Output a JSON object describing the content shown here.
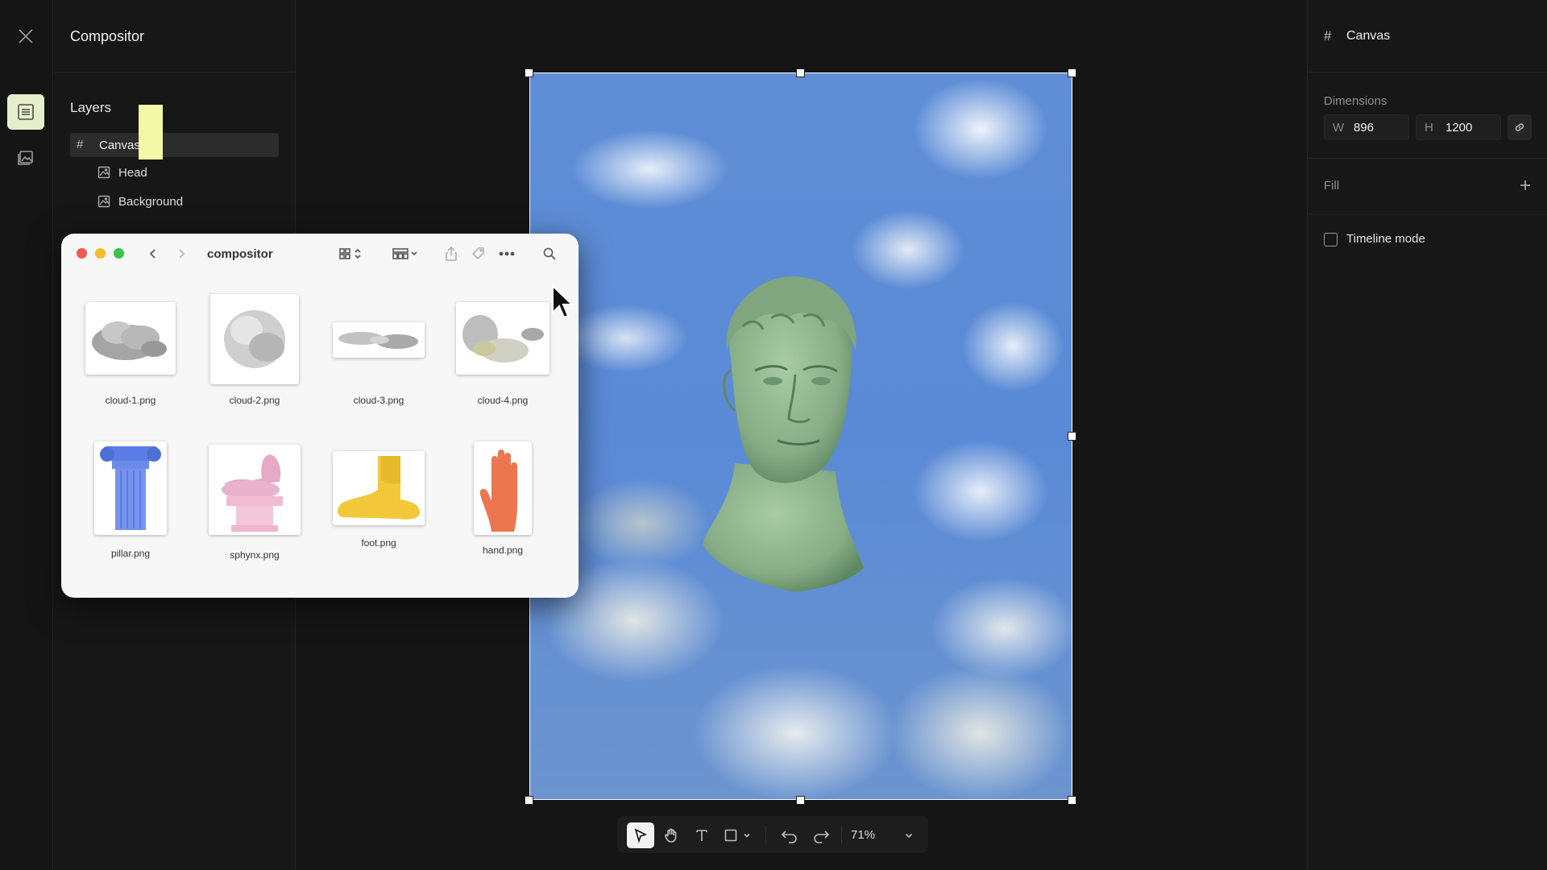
{
  "app": {
    "title": "Compositor"
  },
  "rail": {
    "close_icon": "close-icon",
    "layers_icon": "menu-lines-icon",
    "assets_icon": "images-icon",
    "active_color": "#e7eecb"
  },
  "layers": {
    "title": "Layers",
    "items": [
      {
        "label": "Canvas",
        "icon": "hash-icon",
        "selected": true
      },
      {
        "label": "Head",
        "icon": "image-icon"
      },
      {
        "label": "Background",
        "icon": "image-icon"
      }
    ]
  },
  "finder": {
    "title": "compositor",
    "files": [
      {
        "name": "cloud-1.png"
      },
      {
        "name": "cloud-2.png"
      },
      {
        "name": "cloud-3.png"
      },
      {
        "name": "cloud-4.png"
      },
      {
        "name": "pillar.png"
      },
      {
        "name": "sphynx.png"
      },
      {
        "name": "foot.png"
      },
      {
        "name": "hand.png"
      }
    ]
  },
  "toolbar": {
    "zoom": "71%",
    "tools": [
      "select-tool",
      "hand-tool",
      "text-tool",
      "rectangle-tool",
      "undo",
      "redo"
    ]
  },
  "inspector": {
    "title": "Canvas",
    "dimensions_label": "Dimensions",
    "width_prefix": "W",
    "width": "896",
    "height_prefix": "H",
    "height": "1200",
    "fill_label": "Fill",
    "timeline_label": "Timeline mode",
    "timeline_checked": false
  },
  "colors": {
    "highlight_marker": "#f3f8a6",
    "bust_green": "#8fb48e",
    "sky_blue": "#5f8ed6"
  }
}
